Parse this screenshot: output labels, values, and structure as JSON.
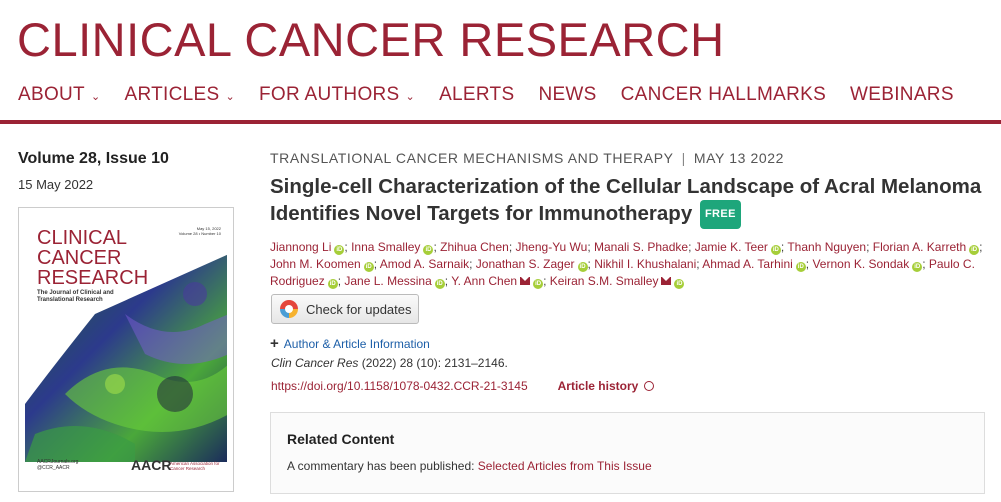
{
  "header": {
    "journal_title": "CLINICAL CANCER RESEARCH",
    "nav": [
      {
        "label": "ABOUT",
        "has_dropdown": true
      },
      {
        "label": "ARTICLES",
        "has_dropdown": true
      },
      {
        "label": "FOR AUTHORS",
        "has_dropdown": true
      },
      {
        "label": "ALERTS",
        "has_dropdown": false
      },
      {
        "label": "NEWS",
        "has_dropdown": false
      },
      {
        "label": "CANCER HALLMARKS",
        "has_dropdown": false
      },
      {
        "label": "WEBINARS",
        "has_dropdown": false
      }
    ],
    "chevron": "⌄"
  },
  "issue": {
    "title": "Volume 28, Issue 10",
    "date": "15 May 2022",
    "cover": {
      "title_lines": [
        "CLINICAL",
        "CANCER",
        "RESEARCH"
      ],
      "subtitle": "The Journal of Clinical and Translational Research",
      "date_line_1": "May 15, 2022",
      "date_line_2": "Volume 28 • Number 10",
      "footer_line_1": "AACRJournals.org",
      "footer_line_2": "@CCR_AACR",
      "logo_text": "AACR",
      "association": "American Association for Cancer Research"
    }
  },
  "article": {
    "category": "TRANSLATIONAL CANCER MECHANISMS AND THERAPY",
    "category_sep": "|",
    "published": "MAY 13 2022",
    "title": "Single-cell Characterization of the Cellular Landscape of Acral Melanoma Identifies Novel Targets for Immunotherapy",
    "free_badge": "FREE",
    "authors": [
      {
        "name": "Jiannong Li",
        "orcid": true,
        "mail": false
      },
      {
        "name": "Inna Smalley",
        "orcid": true,
        "mail": false
      },
      {
        "name": "Zhihua Chen",
        "orcid": false,
        "mail": false
      },
      {
        "name": "Jheng-Yu Wu",
        "orcid": false,
        "mail": false
      },
      {
        "name": "Manali S. Phadke",
        "orcid": false,
        "mail": false
      },
      {
        "name": "Jamie K. Teer",
        "orcid": true,
        "mail": false
      },
      {
        "name": "Thanh Nguyen",
        "orcid": false,
        "mail": false
      },
      {
        "name": "Florian A. Karreth",
        "orcid": true,
        "mail": false
      },
      {
        "name": "John M. Koomen",
        "orcid": true,
        "mail": false
      },
      {
        "name": "Amod A. Sarnaik",
        "orcid": false,
        "mail": false
      },
      {
        "name": "Jonathan S. Zager",
        "orcid": true,
        "mail": false
      },
      {
        "name": "Nikhil I. Khushalani",
        "orcid": false,
        "mail": false
      },
      {
        "name": "Ahmad A. Tarhini",
        "orcid": true,
        "mail": false
      },
      {
        "name": "Vernon K. Sondak",
        "orcid": true,
        "mail": false
      },
      {
        "name": "Paulo C. Rodriguez",
        "orcid": true,
        "mail": false
      },
      {
        "name": "Jane L. Messina",
        "orcid": true,
        "mail": false
      },
      {
        "name": "Y. Ann Chen",
        "orcid": true,
        "mail": true
      },
      {
        "name": "Keiran S.M. Smalley",
        "orcid": true,
        "mail": true
      }
    ],
    "check_updates_label": "Check for updates",
    "author_info_label": "Author & Article Information",
    "citation_journal": "Clin Cancer Res",
    "citation_rest": "(2022) 28 (10): 2131–2146.",
    "doi": "https://doi.org/10.1158/1078-0432.CCR-21-3145",
    "history_label": "Article history"
  },
  "related": {
    "title": "Related Content",
    "text": "A commentary has been published:",
    "link": "Selected Articles from This Issue"
  },
  "colors": {
    "brand": "#9b2335",
    "free": "#1ea67b",
    "orcid": "#a6ce39",
    "link": "#1d5fa8"
  }
}
